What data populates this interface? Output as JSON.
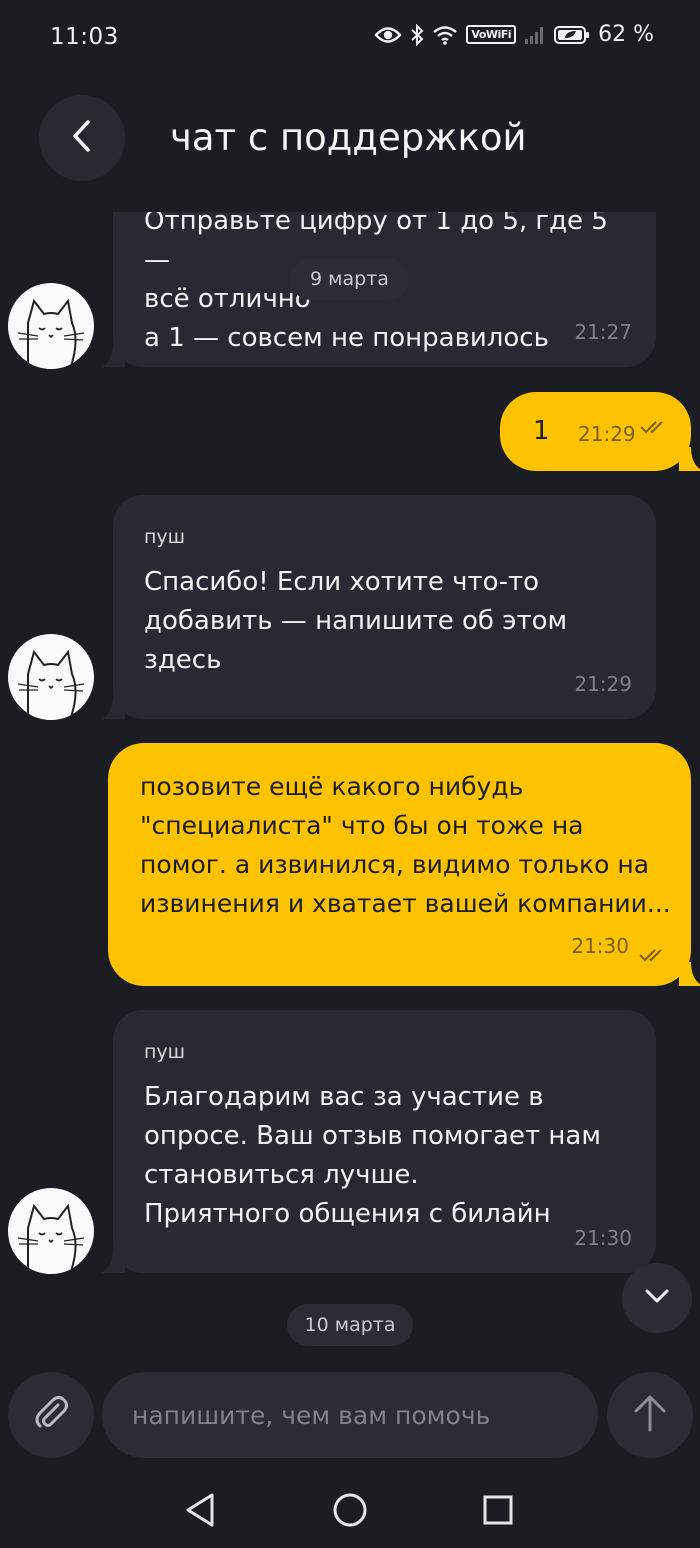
{
  "status_bar": {
    "time": "11:03",
    "network_badge": "VoWiFi",
    "battery": "62 %",
    "icons": [
      "eye-icon",
      "bluetooth-icon",
      "wifi-icon",
      "vowifi-icon",
      "signal-icon",
      "battery-icon"
    ]
  },
  "header": {
    "title": "чат с поддержкой",
    "back_icon": "chevron-left-icon"
  },
  "messages": [
    {
      "direction": "incoming",
      "sender": "",
      "lines": [
        "Отправьте цифру от 1 до 5, где 5 —",
        "всё отлично",
        "а 1 — совсем не понравилось"
      ],
      "time": "21:27"
    },
    {
      "direction": "outgoing",
      "text": "1",
      "time": "21:29",
      "status": "read"
    },
    {
      "direction": "incoming",
      "sender": "пуш",
      "lines": [
        "Спасибо! Если хотите что-то",
        "добавить — напишите об этом",
        "здесь"
      ],
      "time": "21:29"
    },
    {
      "direction": "outgoing",
      "lines": [
        "позовите ещё какого нибудь",
        "\"специалиста\" что бы он тоже на",
        "помог. а извинился, видимо только на",
        "извинения и хватает вашей компании..."
      ],
      "time": "21:30",
      "status": "read"
    },
    {
      "direction": "incoming",
      "sender": "пуш",
      "lines": [
        "Благодарим вас за участие в",
        "опросе. Ваш отзыв помогает нам",
        "становиться лучше.",
        "Приятного общения с билайн"
      ],
      "time": "21:30"
    }
  ],
  "date_separators": {
    "sticky": "9 марта",
    "bottom": "10 марта"
  },
  "composer": {
    "placeholder": "напишите, чем вам помочь",
    "attach_icon": "paperclip-icon",
    "send_icon": "arrow-up-icon"
  },
  "scroll_down_icon": "chevron-down-icon",
  "nav_bar": [
    "back-triangle-icon",
    "home-circle-icon",
    "recents-square-icon"
  ],
  "colors": {
    "background": "#1b1d23",
    "incoming_bubble": "#272a33",
    "outgoing_bubble": "#fdc300",
    "pill": "#2a2d35"
  }
}
